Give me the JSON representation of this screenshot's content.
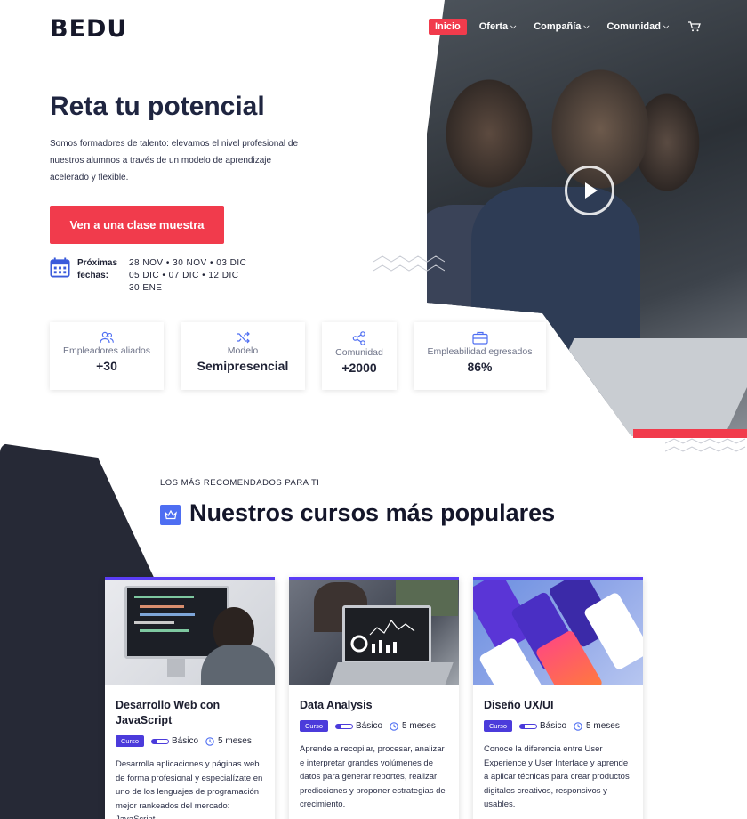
{
  "header": {
    "logo": "BEDU",
    "nav": [
      {
        "label": "Inicio",
        "active": true
      },
      {
        "label": "Oferta"
      },
      {
        "label": "Compañía"
      },
      {
        "label": "Comunidad"
      }
    ]
  },
  "hero": {
    "title": "Reta tu potencial",
    "description": "Somos formadores de talento: elevamos el nivel profesional de nuestros alumnos a través de un modelo de aprendizaje acelerado y flexible.",
    "cta": "Ven a una clase muestra",
    "dates_label": "Próximas fechas:",
    "dates_lines": [
      "28 NOV • 30 NOV • 03 DIC",
      "05 DIC • 07 DIC • 12 DIC",
      "30 ENE"
    ]
  },
  "stats": [
    {
      "label": "Empleadores aliados",
      "value": "+30",
      "icon": "users-icon"
    },
    {
      "label": "Modelo",
      "value": "Semipresencial",
      "icon": "shuffle-icon"
    },
    {
      "label": "Comunidad",
      "value": "+2000",
      "icon": "share-icon"
    },
    {
      "label": "Empleabilidad egresados",
      "value": "86%",
      "icon": "briefcase-icon"
    }
  ],
  "courses_section": {
    "kicker": "LOS MÁS RECOMENDADOS PARA TI",
    "title": "Nuestros cursos más populares"
  },
  "courses": [
    {
      "title": "Desarrollo Web con JavaScript",
      "badge": "Curso",
      "level": "Básico",
      "duration": "5 meses",
      "description": "Desarrolla aplicaciones y páginas web de forma profesional y especialízate en uno de los lenguajes de programación mejor rankeados del mercado: JavaScript."
    },
    {
      "title": "Data Analysis",
      "badge": "Curso",
      "level": "Básico",
      "duration": "5 meses",
      "description": "Aprende a recopilar, procesar, analizar e interpretar grandes volúmenes de datos para generar reportes, realizar predicciones y proponer estrategias de crecimiento."
    },
    {
      "title": "Diseño UX/UI",
      "badge": "Curso",
      "level": "Básico",
      "duration": "5 meses",
      "description": "Conoce la diferencia entre User Experience y User Interface y aprende a aplicar técnicas para crear productos digitales creativos, responsivos y usables."
    }
  ],
  "colors": {
    "accent": "#f13b4c",
    "primary": "#4b3bdb",
    "dark": "#262936"
  }
}
